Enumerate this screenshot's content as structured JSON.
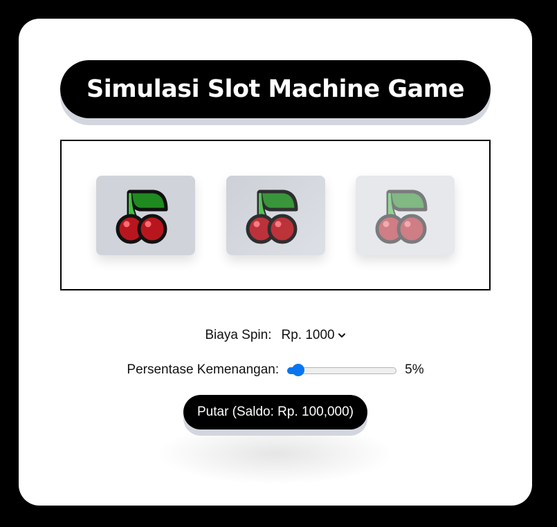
{
  "title": "Simulasi Slot Machine Game",
  "reels": [
    {
      "symbol": "cherry-icon"
    },
    {
      "symbol": "cherry-icon"
    },
    {
      "symbol": "cherry-icon"
    }
  ],
  "cost": {
    "label": "Biaya Spin:",
    "selected": "Rp. 1000"
  },
  "win_percentage": {
    "label": "Persentase Kemenangan:",
    "value": 5,
    "min": 0,
    "max": 100,
    "display": "5%"
  },
  "spin_button": {
    "label": "Putar (Saldo: Rp. 100,000)"
  },
  "colors": {
    "background": "#000000",
    "card": "#ffffff",
    "accent": "#0a75f0",
    "button": "#000000"
  }
}
